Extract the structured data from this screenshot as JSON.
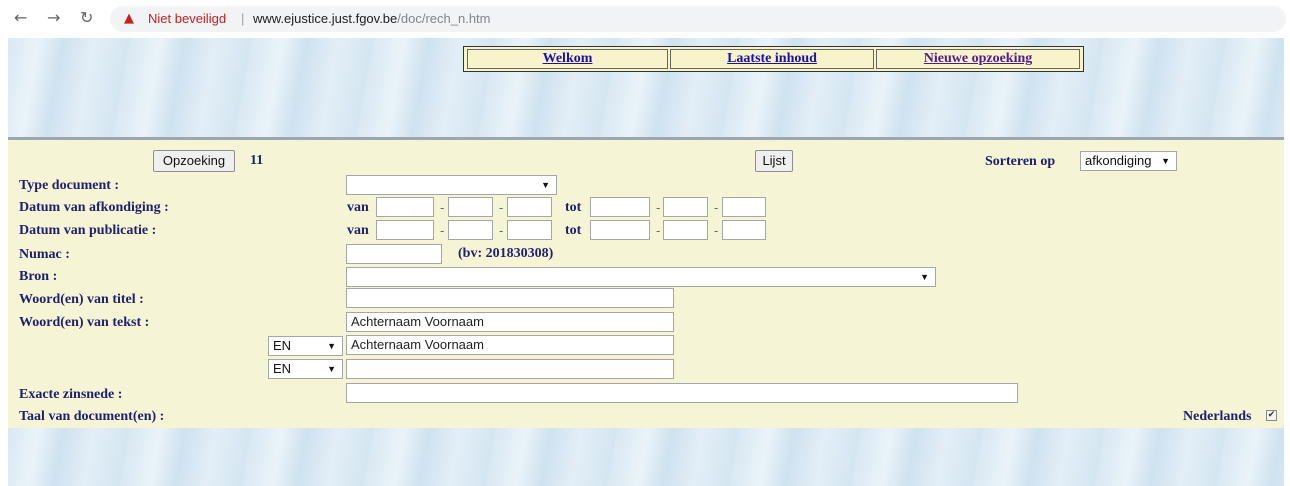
{
  "browser": {
    "security_label": "Niet beveiligd",
    "separator": "|",
    "url_host": "www.ejustice.just.fgov.be",
    "url_path": "/doc/rech_n.htm",
    "icons": [
      "back-arrow-icon",
      "forward-arrow-icon",
      "reload-icon",
      "warning-icon"
    ]
  },
  "nav": {
    "welkom": "Welkom",
    "laatste": "Laatste inhoud",
    "nieuwe": "Nieuwe opzoeking"
  },
  "toolbar": {
    "search_button": "Opzoeking",
    "count": "11",
    "list_button": "Lijst",
    "sort_label": "Sorteren op",
    "sort_value": "afkondiging"
  },
  "form": {
    "type_document": {
      "label": "Type document :",
      "value": ""
    },
    "datum_afkondiging": {
      "label": "Datum van afkondiging :",
      "van": "van",
      "tot": "tot",
      "dash": "-"
    },
    "datum_publicatie": {
      "label": "Datum van publicatie :",
      "van": "van",
      "tot": "tot",
      "dash": "-"
    },
    "numac": {
      "label": "Numac :",
      "value": "",
      "hint": "(bv: 201830308)"
    },
    "bron": {
      "label": "Bron :",
      "value": ""
    },
    "titel": {
      "label": "Woord(en) van titel :",
      "value": ""
    },
    "tekst": {
      "label": "Woord(en) van tekst :",
      "value1": "Achternaam Voornaam",
      "op2": "EN",
      "value2": "Achternaam Voornaam",
      "op3": "EN",
      "value3": ""
    },
    "exacte": {
      "label": "Exacte zinsnede :",
      "value": ""
    },
    "taal": {
      "label": "Taal van document(en) :",
      "option": "Nederlands",
      "checked": true
    }
  }
}
